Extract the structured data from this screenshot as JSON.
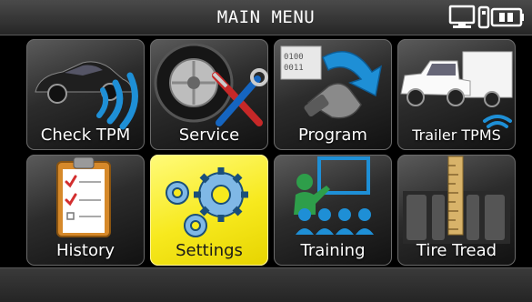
{
  "header": {
    "title": "MAIN MENU"
  },
  "status": {
    "pc_icon": "computer-icon",
    "battery_icon": "battery-icon"
  },
  "menu": {
    "items": [
      {
        "label": "Check TPM",
        "icon": "car-signal-icon"
      },
      {
        "label": "Service",
        "icon": "tire-tools-icon"
      },
      {
        "label": "Program",
        "icon": "program-sensor-icon"
      },
      {
        "label": "Trailer TPMS",
        "icon": "truck-trailer-icon"
      },
      {
        "label": "History",
        "icon": "clipboard-icon"
      },
      {
        "label": "Settings",
        "icon": "gears-icon",
        "selected": true
      },
      {
        "label": "Training",
        "icon": "training-icon"
      },
      {
        "label": "Tire Tread",
        "icon": "tread-gauge-icon"
      }
    ]
  },
  "colors": {
    "selected_tile": "#f7e91e",
    "tile": "#2c2c2c",
    "accent_blue": "#1e8fd6"
  }
}
